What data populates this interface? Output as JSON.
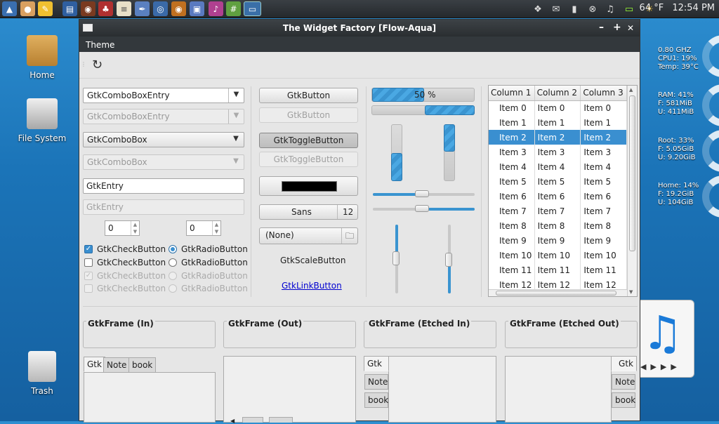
{
  "panel": {
    "clock": "12:54 PM",
    "weather": "64 °F",
    "launchers": [
      "start-icon",
      "firefox-icon",
      "notes-icon",
      "writer-icon",
      "music-icon",
      "games-icon",
      "editor-icon",
      "inkscape-icon",
      "browser-icon",
      "eye-icon",
      "photos-icon",
      "media-icon",
      "terminal-icon",
      "window-icon"
    ]
  },
  "desktop": {
    "icons": [
      "Home",
      "File System",
      "Trash"
    ]
  },
  "conky": {
    "cpu": [
      "0.80 GHZ",
      "CPU1: 19%",
      "Temp: 39°C"
    ],
    "ram": [
      "RAM: 41%",
      "F: 581MiB",
      "U: 411MiB"
    ],
    "root": [
      "Root: 33%",
      "F: 5.05GiB",
      "U: 9.20GiB"
    ],
    "home": [
      "Home: 14%",
      "F: 19.2GiB",
      "U: 104GiB"
    ]
  },
  "window": {
    "title": "The Widget Factory [Flow-Aqua]",
    "menu": [
      "Theme"
    ],
    "controls": {
      "minimize": "–",
      "maximize": "+",
      "close": "✕"
    }
  },
  "col1": {
    "combo_entry": "GtkComboBoxEntry",
    "combo_entry_dis": "GtkComboBoxEntry",
    "combo": "GtkComboBox",
    "combo_dis": "GtkComboBox",
    "entry": "GtkEntry",
    "entry_dis": "GtkEntry",
    "spin1": "0",
    "spin2": "0",
    "check": [
      "GtkCheckButton",
      "GtkCheckButton",
      "GtkCheckButton",
      "GtkCheckButton"
    ],
    "radio": [
      "GtkRadioButton",
      "GtkRadioButton",
      "GtkRadioButton",
      "GtkRadioButton"
    ]
  },
  "col2": {
    "button": "GtkButton",
    "button_dis": "GtkButton",
    "toggle": "GtkToggleButton",
    "toggle_dis": "GtkToggleButton",
    "color": "#000000",
    "font_name": "Sans",
    "font_size": "12",
    "file": "(None)",
    "scale_button": "GtkScaleButton",
    "link": "GtkLinkButton"
  },
  "progress": {
    "label": "50 %",
    "value": 0.5
  },
  "tree": {
    "columns": [
      "Column 1",
      "Column 2",
      "Column 3"
    ],
    "rows": [
      "Item 0",
      "Item 1",
      "Item 2",
      "Item 3",
      "Item 4",
      "Item 5",
      "Item 6",
      "Item 7",
      "Item 8",
      "Item 9",
      "Item 10",
      "Item 11",
      "Item 12"
    ],
    "selected": 2
  },
  "frames": [
    "GtkFrame (In)",
    "GtkFrame (Out)",
    "GtkFrame (Etched In)",
    "GtkFrame (Etched Out)"
  ],
  "notebooks": {
    "tabs": [
      "Gtk",
      "Note",
      "book"
    ]
  },
  "colors": {
    "accent": "#3a8fd0",
    "titlebar": "#2f3438"
  }
}
